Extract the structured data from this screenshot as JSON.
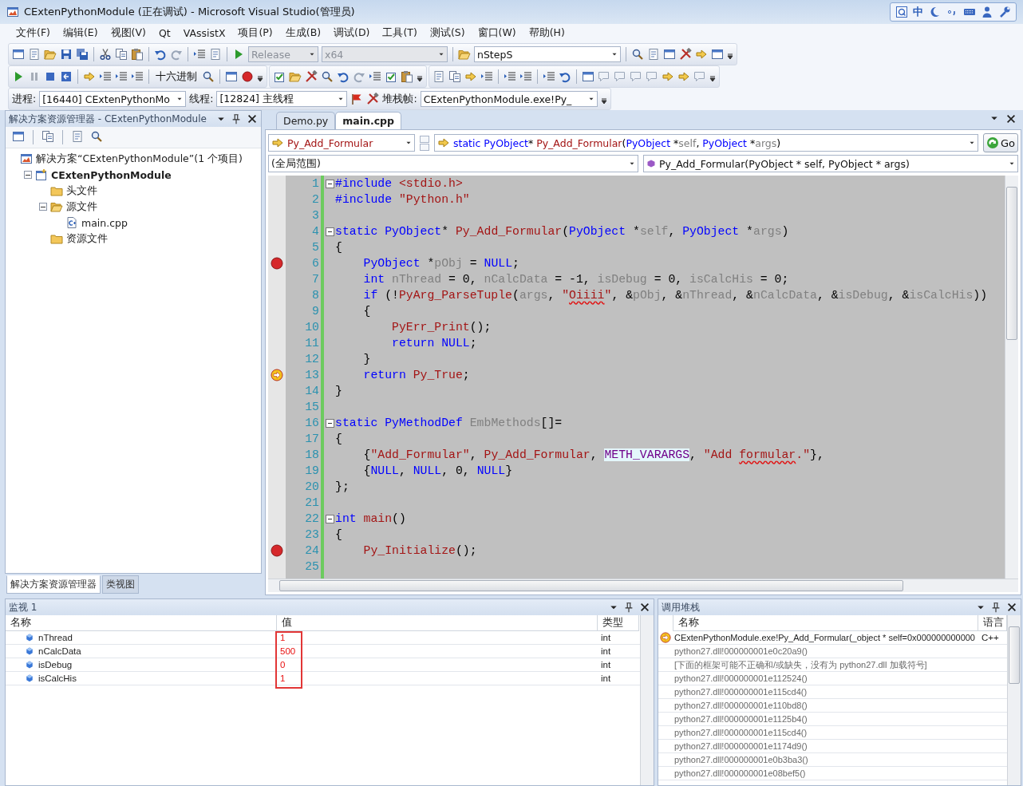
{
  "window": {
    "title": "CExtenPythonModule (正在调试) - Microsoft Visual Studio(管理员)"
  },
  "ime_bar": {
    "mode": "中"
  },
  "menu": [
    "文件(F)",
    "编辑(E)",
    "视图(V)",
    "Qt",
    "VAssistX",
    "项目(P)",
    "生成(B)",
    "调试(D)",
    "工具(T)",
    "测试(S)",
    "窗口(W)",
    "帮助(H)"
  ],
  "toolbar": {
    "configuration": {
      "value": "Release",
      "disabled": true
    },
    "platform": {
      "value": "x64",
      "disabled": true
    },
    "find": {
      "value": "nStepS",
      "disabled": false
    },
    "hex_button": "十六进制"
  },
  "debug_location": {
    "process_label": "进程:",
    "process": "[16440] CExtenPythonMo",
    "thread_label": "线程:",
    "thread": "[12824] 主线程",
    "frame_label": "堆栈帧:",
    "frame": "CExtenPythonModule.exe!Py_"
  },
  "solution_explorer": {
    "title": "解决方案资源管理器 - CExtenPythonModule",
    "tree": [
      {
        "label": "解决方案“CExtenPythonModule”(1 个项目)",
        "kind": "solution",
        "children": [
          {
            "label": "CExtenPythonModule",
            "kind": "project",
            "bold": true,
            "expanded": true,
            "children": [
              {
                "label": "头文件",
                "kind": "folder"
              },
              {
                "label": "源文件",
                "kind": "folder",
                "expanded": true,
                "children": [
                  {
                    "label": "main.cpp",
                    "kind": "file"
                  }
                ]
              },
              {
                "label": "资源文件",
                "kind": "folder"
              }
            ]
          }
        ]
      }
    ],
    "tabs": [
      {
        "label": "解决方案资源管理器",
        "selected": true
      },
      {
        "label": "类视图",
        "selected": false
      }
    ]
  },
  "editor": {
    "tabs": [
      {
        "label": "Demo.py",
        "selected": false
      },
      {
        "label": "main.cpp",
        "selected": true
      }
    ],
    "nav": {
      "member": "Py_Add_Formular",
      "signature": [
        {
          "kind": "kw",
          "text": "static "
        },
        {
          "kind": "kw",
          "text": "PyObject"
        },
        {
          "kind": "txt",
          "text": "* "
        },
        {
          "kind": "fn",
          "text": "Py_Add_Formular"
        },
        {
          "kind": "txt",
          "text": "("
        },
        {
          "kind": "kw",
          "text": "PyObject"
        },
        {
          "kind": "txt",
          "text": " *"
        },
        {
          "kind": "var",
          "text": "self"
        },
        {
          "kind": "txt",
          "text": ", "
        },
        {
          "kind": "kw",
          "text": "PyObject"
        },
        {
          "kind": "txt",
          "text": " *"
        },
        {
          "kind": "var",
          "text": "args"
        },
        {
          "kind": "txt",
          "text": ")"
        }
      ],
      "go": "Go",
      "scope": "(全局范围)",
      "function": "Py_Add_Formular(PyObject * self, PyObject * args)"
    },
    "lines": [
      {
        "n": "1",
        "fold": true,
        "breakpoint": false,
        "current": false,
        "tokens": [
          {
            "kind": "kw",
            "text": "#include "
          },
          {
            "kind": "str",
            "text": "<stdio.h>"
          }
        ]
      },
      {
        "n": "2",
        "fold": false,
        "breakpoint": false,
        "current": false,
        "tokens": [
          {
            "kind": "kw",
            "text": "#include "
          },
          {
            "kind": "str",
            "text": "\"Python.h\""
          }
        ]
      },
      {
        "n": "3",
        "fold": false,
        "breakpoint": false,
        "current": false
      },
      {
        "n": "4",
        "fold": true,
        "breakpoint": false,
        "current": false,
        "tokens": [
          {
            "kind": "kw",
            "text": "static "
          },
          {
            "kind": "kw",
            "text": "PyObject"
          },
          {
            "kind": "txt",
            "text": "* "
          },
          {
            "kind": "fn",
            "text": "Py_Add_Formular"
          },
          {
            "kind": "txt",
            "text": "("
          },
          {
            "kind": "kw",
            "text": "PyObject"
          },
          {
            "kind": "txt",
            "text": " *"
          },
          {
            "kind": "var",
            "text": "self"
          },
          {
            "kind": "txt",
            "text": ", "
          },
          {
            "kind": "kw",
            "text": "PyObject"
          },
          {
            "kind": "txt",
            "text": " *"
          },
          {
            "kind": "var",
            "text": "args"
          },
          {
            "kind": "txt",
            "text": ")"
          }
        ]
      },
      {
        "n": "5",
        "fold": false,
        "breakpoint": false,
        "current": false,
        "tokens": [
          {
            "kind": "txt",
            "text": "{"
          }
        ]
      },
      {
        "n": "6",
        "fold": false,
        "breakpoint": true,
        "current": false,
        "tokens": [
          {
            "kind": "kw",
            "text": "    PyObject"
          },
          {
            "kind": "txt",
            "text": " *"
          },
          {
            "kind": "var",
            "text": "pObj"
          },
          {
            "kind": "txt",
            "text": " = "
          },
          {
            "kind": "kw",
            "text": "NULL"
          },
          {
            "kind": "txt",
            "text": ";"
          }
        ]
      },
      {
        "n": "7",
        "fold": false,
        "breakpoint": false,
        "current": false,
        "tokens": [
          {
            "kind": "kw",
            "text": "    int"
          },
          {
            "kind": "var",
            "text": " nThread"
          },
          {
            "kind": "txt",
            "text": " = 0, "
          },
          {
            "kind": "var",
            "text": "nCalcData"
          },
          {
            "kind": "txt",
            "text": " = -1, "
          },
          {
            "kind": "var",
            "text": "isDebug"
          },
          {
            "kind": "txt",
            "text": " = 0, "
          },
          {
            "kind": "var",
            "text": "isCalcHis"
          },
          {
            "kind": "txt",
            "text": " = 0;"
          }
        ]
      },
      {
        "n": "8",
        "fold": false,
        "breakpoint": false,
        "current": false,
        "tokens": [
          {
            "kind": "kw",
            "text": "    if"
          },
          {
            "kind": "txt",
            "text": " (!"
          },
          {
            "kind": "fn",
            "text": "PyArg_ParseTuple"
          },
          {
            "kind": "txt",
            "text": "("
          },
          {
            "kind": "var",
            "text": "args"
          },
          {
            "kind": "txt",
            "text": ", "
          },
          {
            "kind": "str",
            "text": "\""
          },
          {
            "kind": "str",
            "text": "Oiiii",
            "squiggle": true
          },
          {
            "kind": "str",
            "text": "\""
          },
          {
            "kind": "txt",
            "text": ", &"
          },
          {
            "kind": "var",
            "text": "pObj"
          },
          {
            "kind": "txt",
            "text": ", &"
          },
          {
            "kind": "var",
            "text": "nThread"
          },
          {
            "kind": "txt",
            "text": ", &"
          },
          {
            "kind": "var",
            "text": "nCalcData"
          },
          {
            "kind": "txt",
            "text": ", &"
          },
          {
            "kind": "var",
            "text": "isDebug"
          },
          {
            "kind": "txt",
            "text": ", &"
          },
          {
            "kind": "var",
            "text": "isCalcHis"
          },
          {
            "kind": "txt",
            "text": "))"
          }
        ]
      },
      {
        "n": "9",
        "fold": false,
        "breakpoint": false,
        "current": false,
        "tokens": [
          {
            "kind": "txt",
            "text": "    {"
          }
        ]
      },
      {
        "n": "10",
        "fold": false,
        "breakpoint": false,
        "current": false,
        "tokens": [
          {
            "kind": "fn",
            "text": "        PyErr_Print"
          },
          {
            "kind": "txt",
            "text": "();"
          }
        ]
      },
      {
        "n": "11",
        "fold": false,
        "breakpoint": false,
        "current": false,
        "tokens": [
          {
            "kind": "kw",
            "text": "        return"
          },
          {
            "kind": "kw",
            "text": " NULL"
          },
          {
            "kind": "txt",
            "text": ";"
          }
        ]
      },
      {
        "n": "12",
        "fold": false,
        "breakpoint": false,
        "current": false,
        "tokens": [
          {
            "kind": "txt",
            "text": "    }"
          }
        ]
      },
      {
        "n": "13",
        "fold": false,
        "breakpoint": false,
        "current": true,
        "tokens": [
          {
            "kind": "kw",
            "text": "    return"
          },
          {
            "kind": "fn",
            "text": " Py_True"
          },
          {
            "kind": "txt",
            "text": ";"
          }
        ]
      },
      {
        "n": "14",
        "fold": false,
        "breakpoint": false,
        "current": false,
        "tokens": [
          {
            "kind": "txt",
            "text": "}"
          }
        ]
      },
      {
        "n": "15",
        "fold": false,
        "breakpoint": false,
        "current": false
      },
      {
        "n": "16",
        "fold": true,
        "breakpoint": false,
        "current": false,
        "tokens": [
          {
            "kind": "kw",
            "text": "static "
          },
          {
            "kind": "kw",
            "text": "PyMethodDef"
          },
          {
            "kind": "var",
            "text": " EmbMethods"
          },
          {
            "kind": "txt",
            "text": "[]="
          }
        ]
      },
      {
        "n": "17",
        "fold": false,
        "breakpoint": false,
        "current": false,
        "tokens": [
          {
            "kind": "txt",
            "text": "{"
          }
        ]
      },
      {
        "n": "18",
        "fold": false,
        "breakpoint": false,
        "current": false,
        "tokens": [
          {
            "kind": "txt",
            "text": "    {"
          },
          {
            "kind": "str",
            "text": "\"Add_Formular\""
          },
          {
            "kind": "txt",
            "text": ", "
          },
          {
            "kind": "fn",
            "text": "Py_Add_Formular"
          },
          {
            "kind": "txt",
            "text": ", "
          },
          {
            "kind": "macro",
            "text": "METH_VARARGS"
          },
          {
            "kind": "txt",
            "text": ", "
          },
          {
            "kind": "str",
            "text": "\"Add "
          },
          {
            "kind": "str",
            "text": "formular",
            "squiggle": true
          },
          {
            "kind": "str",
            "text": ".\""
          },
          {
            "kind": "txt",
            "text": "},"
          }
        ]
      },
      {
        "n": "19",
        "fold": false,
        "breakpoint": false,
        "current": false,
        "tokens": [
          {
            "kind": "txt",
            "text": "    {"
          },
          {
            "kind": "kw",
            "text": "NULL"
          },
          {
            "kind": "txt",
            "text": ", "
          },
          {
            "kind": "kw",
            "text": "NULL"
          },
          {
            "kind": "txt",
            "text": ", 0, "
          },
          {
            "kind": "kw",
            "text": "NULL"
          },
          {
            "kind": "txt",
            "text": "}"
          }
        ]
      },
      {
        "n": "20",
        "fold": false,
        "breakpoint": false,
        "current": false,
        "tokens": [
          {
            "kind": "txt",
            "text": "};"
          }
        ]
      },
      {
        "n": "21",
        "fold": false,
        "breakpoint": false,
        "current": false
      },
      {
        "n": "22",
        "fold": true,
        "breakpoint": false,
        "current": false,
        "tokens": [
          {
            "kind": "kw",
            "text": "int"
          },
          {
            "kind": "fn",
            "text": " main"
          },
          {
            "kind": "txt",
            "text": "()"
          }
        ]
      },
      {
        "n": "23",
        "fold": false,
        "breakpoint": false,
        "current": false,
        "tokens": [
          {
            "kind": "txt",
            "text": "{"
          }
        ]
      },
      {
        "n": "24",
        "fold": false,
        "breakpoint": true,
        "current": false,
        "tokens": [
          {
            "kind": "fn",
            "text": "    Py_Initialize"
          },
          {
            "kind": "txt",
            "text": "();"
          }
        ]
      },
      {
        "n": "25",
        "fold": false,
        "breakpoint": false,
        "current": false
      }
    ]
  },
  "watch": {
    "title": "监视 1",
    "columns": [
      "名称",
      "值",
      "类型"
    ],
    "value_highlight": true,
    "rows": [
      {
        "name": "nThread",
        "value": "1",
        "type": "int",
        "changed": true
      },
      {
        "name": "nCalcData",
        "value": "500",
        "type": "int",
        "changed": true
      },
      {
        "name": "isDebug",
        "value": "0",
        "type": "int",
        "changed": true
      },
      {
        "name": "isCalcHis",
        "value": "1",
        "type": "int",
        "changed": true
      }
    ]
  },
  "call_stack": {
    "title": "调用堆栈",
    "columns": [
      "名称",
      "语言"
    ],
    "rows": [
      {
        "name": "CExtenPythonModule.exe!Py_Add_Formular(_object * self=0x000000000000",
        "language": "C++",
        "current": true,
        "dimmed": false
      },
      {
        "name": "python27.dll!000000001e0c20a9()",
        "current": false,
        "dimmed": true
      },
      {
        "name": "[下面的框架可能不正确和/或缺失，没有为 python27.dll 加载符号]",
        "current": false,
        "dimmed": true
      },
      {
        "name": "python27.dll!000000001e112524()",
        "current": false,
        "dimmed": true
      },
      {
        "name": "python27.dll!000000001e115cd4()",
        "current": false,
        "dimmed": true
      },
      {
        "name": "python27.dll!000000001e110bd8()",
        "current": false,
        "dimmed": true
      },
      {
        "name": "python27.dll!000000001e1125b4()",
        "current": false,
        "dimmed": true
      },
      {
        "name": "python27.dll!000000001e115cd4()",
        "current": false,
        "dimmed": true
      },
      {
        "name": "python27.dll!000000001e1174d9()",
        "current": false,
        "dimmed": true
      },
      {
        "name": "python27.dll!000000001e0b3ba3()",
        "current": false,
        "dimmed": true
      },
      {
        "name": "python27.dll!000000001e08bef5()",
        "current": false,
        "dimmed": true
      }
    ]
  }
}
